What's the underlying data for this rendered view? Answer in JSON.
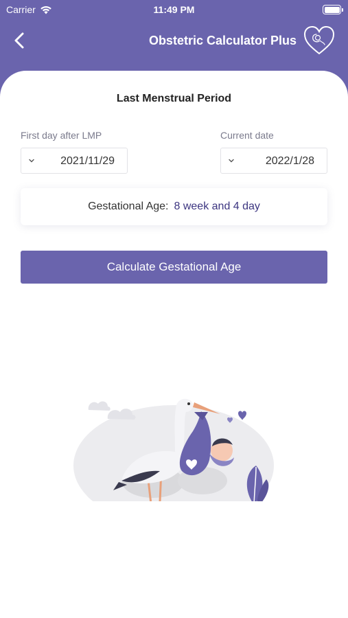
{
  "status_bar": {
    "carrier": "Carrier",
    "time": "11:49 PM"
  },
  "nav": {
    "title": "Obstetric Calculator Plus",
    "back_icon": "chevron-left-icon",
    "logo_icon": "heart-logo-icon"
  },
  "form": {
    "section_title": "Last Menstrual Period",
    "lmp_label": "First day after LMP",
    "lmp_value": "2021/11/29",
    "current_label": "Current date",
    "current_value": "2022/1/28"
  },
  "result": {
    "label": "Gestational Age:",
    "value": "8 week and 4 day"
  },
  "actions": {
    "calculate_label": "Calculate Gestational Age"
  },
  "colors": {
    "primary": "#6a64ad",
    "accent_text": "#3c3580",
    "card": "#ffffff"
  }
}
